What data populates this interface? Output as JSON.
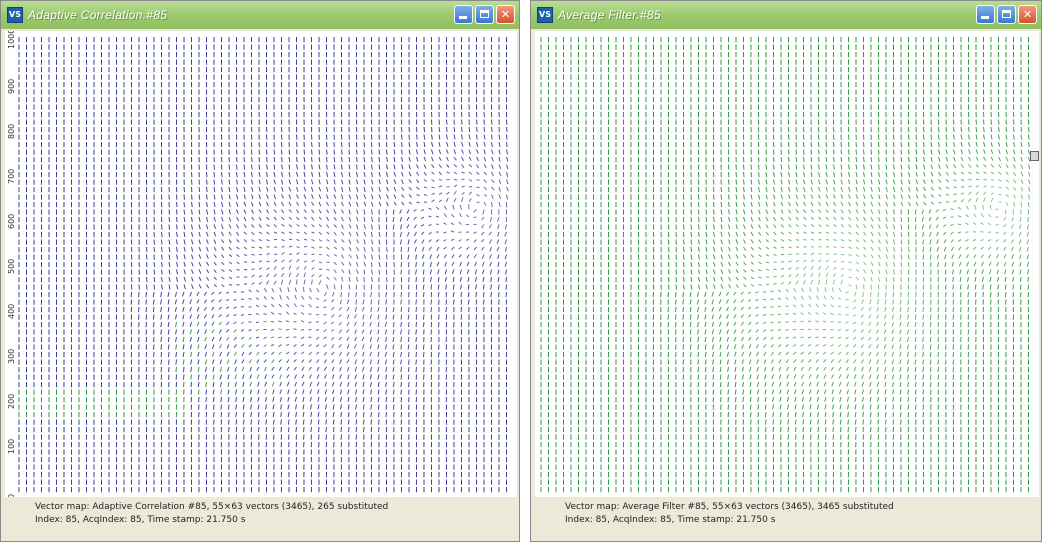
{
  "windows": [
    {
      "id": "left",
      "title": "Adaptive Correlation.#85",
      "status_line1": "Vector map: Adaptive Correlation #85, 55×63 vectors (3465), 265 substituted",
      "status_line2": "Index: 85, AcqIndex: 85, Time stamp: 21.750 s",
      "y_ticks": [
        "0",
        "100",
        "200",
        "300",
        "400",
        "500",
        "600",
        "700",
        "800",
        "900",
        "1000"
      ],
      "colors": {
        "primary": "#3b3f9c",
        "substituted": "#2f9a3e"
      }
    },
    {
      "id": "right",
      "title": "Average Filter.#85",
      "status_line1": "Vector map: Average Filter #85, 55×63 vectors (3465), 3465 substituted",
      "status_line2": "Index: 85, AcqIndex: 85, Time stamp: 21.750 s",
      "colors": {
        "primary": "#2f9a3e"
      }
    }
  ],
  "icons": {
    "app": "vector-map-icon",
    "minimize": "minimize-icon",
    "maximize": "maximize-icon",
    "close": "close-icon"
  }
}
